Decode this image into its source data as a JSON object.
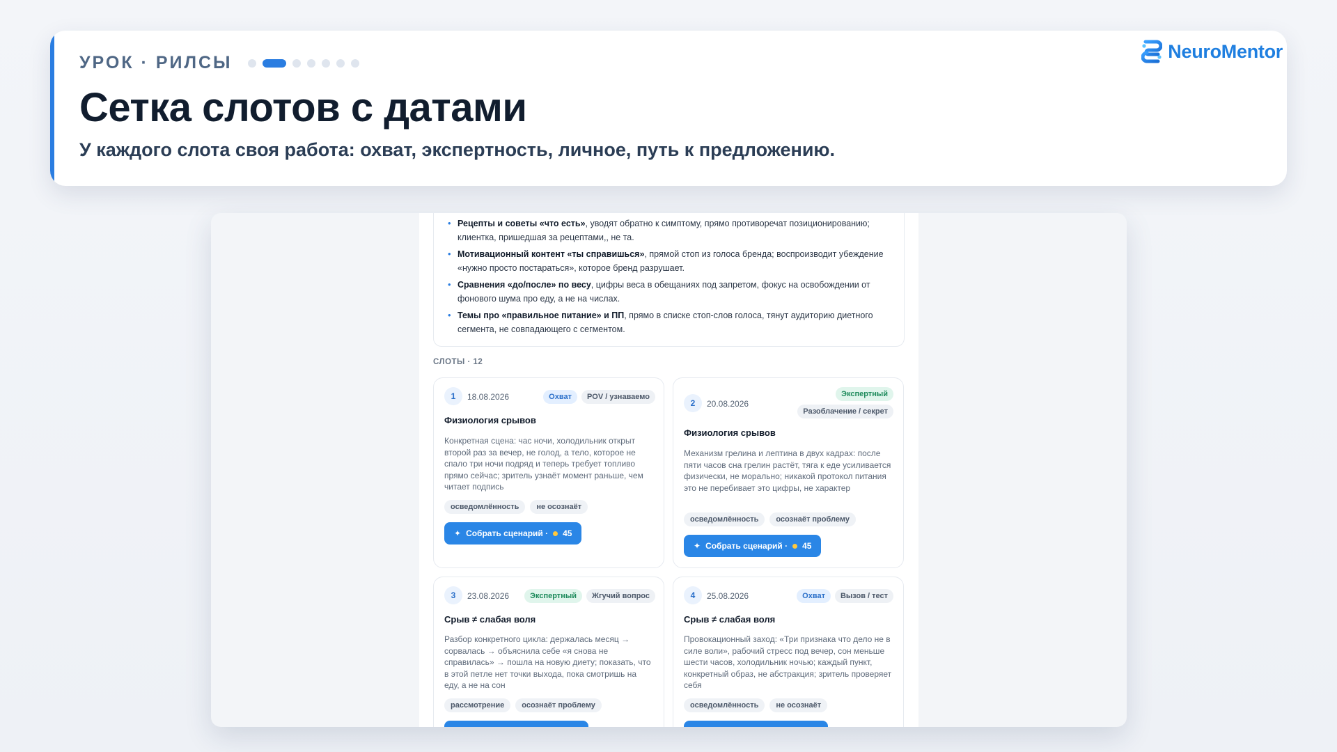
{
  "header": {
    "eyebrow": "УРОК · РИЛСЫ",
    "progress": {
      "total": 7,
      "current": 2
    },
    "title": "Сетка слотов с датами",
    "subtitle": "У каждого слота своя работа: охват, экспертность, личное, путь к предложению.",
    "brand": "NeuroMentor"
  },
  "stop_list": [
    {
      "bold": "Рецепты и советы «что есть»",
      "text": ", уводят обратно к симптому, прямо противоречат позиционированию; клиентка, пришедшая за рецептами,, не та."
    },
    {
      "bold": "Мотивационный контент «ты справишься»",
      "text": ", прямой стоп из голоса бренда; воспроизводит убеждение «нужно просто постараться», которое бренд разрушает."
    },
    {
      "bold": "Сравнения «до/после» по весу",
      "text": ", цифры веса в обещаниях под запретом, фокус на освобождении от фонового шума про еду, а не на числах."
    },
    {
      "bold": "Темы про «правильное питание» и ПП",
      "text": ", прямо в списке стоп-слов голоса, тянут аудиторию диетного сегмента, не совпадающего с сегментом."
    }
  ],
  "slots_label": "СЛОТЫ · 12",
  "slots": [
    {
      "num": "1",
      "date": "18.08.2026",
      "tags": [
        {
          "label": "Охват",
          "kind": "reach"
        },
        {
          "label": "POV / узнаваемо",
          "kind": "format"
        }
      ],
      "title": "Физиология срывов",
      "desc": "Конкретная сцена: час ночи, холодильник открыт второй раз за вечер, не голод, а тело, которое не спало три ночи подряд и теперь требует топливо прямо сейчас; зритель узнаёт момент раньше, чем читает подпись",
      "chips": [
        "осведомлённость",
        "не осознаёт"
      ],
      "cta": "Собрать сценарий ·",
      "cost": "45"
    },
    {
      "num": "2",
      "date": "20.08.2026",
      "tags": [
        {
          "label": "Экспертный",
          "kind": "expert"
        },
        {
          "label": "Разоблачение / секрет",
          "kind": "format"
        }
      ],
      "title": "Физиология срывов",
      "desc": "Механизм грелина и лептина в двух кадрах: после пяти часов сна грелин растёт, тяга к еде усиливается физически, не морально; никакой протокол питания это не перебивает это цифры, не характер",
      "chips": [
        "осведомлённость",
        "осознаёт проблему"
      ],
      "cta": "Собрать сценарий ·",
      "cost": "45"
    },
    {
      "num": "3",
      "date": "23.08.2026",
      "tags": [
        {
          "label": "Экспертный",
          "kind": "expert"
        },
        {
          "label": "Жгучий вопрос",
          "kind": "format"
        }
      ],
      "title": "Срыв ≠ слабая воля",
      "desc": "Разбор конкретного цикла: держалась месяц → сорвалась → объяснила себе «я снова не справилась» → пошла на новую диету; показать, что в этой петле нет точки выхода, пока смотришь на еду, а не на сон",
      "chips": [
        "рассмотрение",
        "осознаёт проблему"
      ]
    },
    {
      "num": "4",
      "date": "25.08.2026",
      "tags": [
        {
          "label": "Охват",
          "kind": "reach"
        },
        {
          "label": "Вызов / тест",
          "kind": "format"
        }
      ],
      "title": "Срыв ≠ слабая воля",
      "desc": "Провокационный заход: «Три признака что дело не в силе воли», рабочий стресс под вечер, сон меньше шести часов, холодильник ночью; каждый пункт, конкретный образ, не абстракция; зритель проверяет себя",
      "chips": [
        "осведомлённость",
        "не осознаёт"
      ]
    }
  ]
}
